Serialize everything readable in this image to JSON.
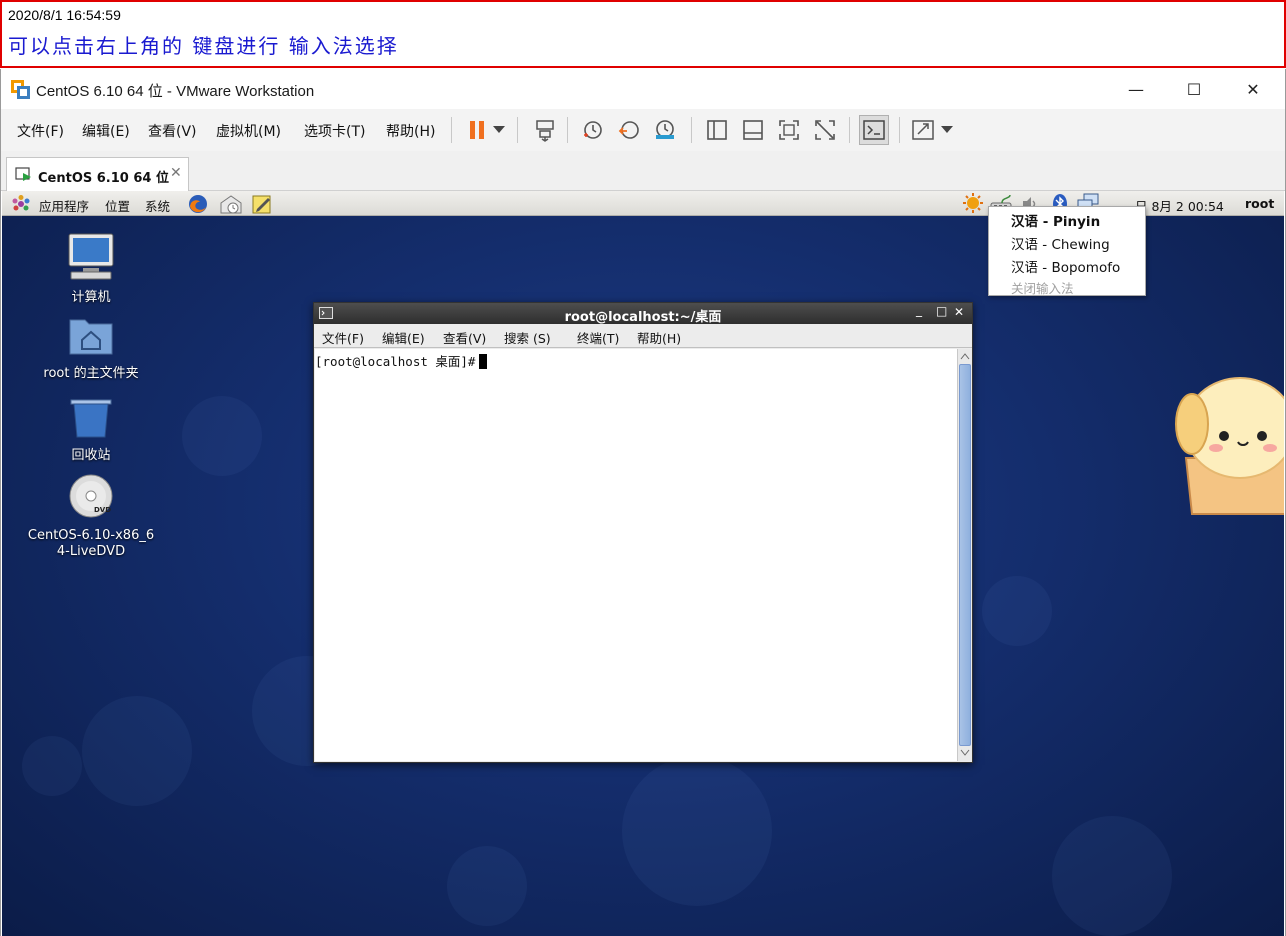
{
  "banner": {
    "timestamp": "2020/8/1 16:54:59",
    "note": "可以点击右上角的 键盘进行 输入法选择"
  },
  "window": {
    "title": "CentOS 6.10 64 位 - VMware Workstation",
    "minimize": "—",
    "maximize": "☐",
    "close": "✕"
  },
  "menubar": {
    "items": [
      "文件(F)",
      "编辑(E)",
      "查看(V)",
      "虚拟机(M)",
      "选项卡(T)",
      "帮助(H)"
    ]
  },
  "tab": {
    "label": "CentOS 6.10 64 位",
    "close": "✕"
  },
  "gnome_panel": {
    "applications": "应用程序",
    "places": "位置",
    "system": "系统",
    "clock": "日 8月  2 00:54",
    "user": "root"
  },
  "desktop_icons": [
    {
      "label": "计算机"
    },
    {
      "label": "root 的主文件夹"
    },
    {
      "label": "回收站"
    },
    {
      "label": "CentOS-6.10-x86_64-LiveDVD"
    }
  ],
  "terminal": {
    "title": "root@localhost:~/桌面",
    "menu": [
      "文件(F)",
      "编辑(E)",
      "查看(V)",
      "搜索 (S)",
      "终端(T)",
      "帮助(H)"
    ],
    "prompt": "[root@localhost 桌面]#",
    "minimize": "_",
    "maximize": "□",
    "close": "✕"
  },
  "im_menu": {
    "items": [
      {
        "label": "汉语 - Pinyin",
        "active": true
      },
      {
        "label": "汉语 - Chewing",
        "active": false
      },
      {
        "label": "汉语 - Bopomofo",
        "active": false
      }
    ],
    "disable": "关闭输入法"
  },
  "colors": {
    "banner_border": "#e00000",
    "banner_note": "#1a1ad0",
    "pause_accent": "#f07020",
    "desktop_blue": "#142d6c"
  }
}
